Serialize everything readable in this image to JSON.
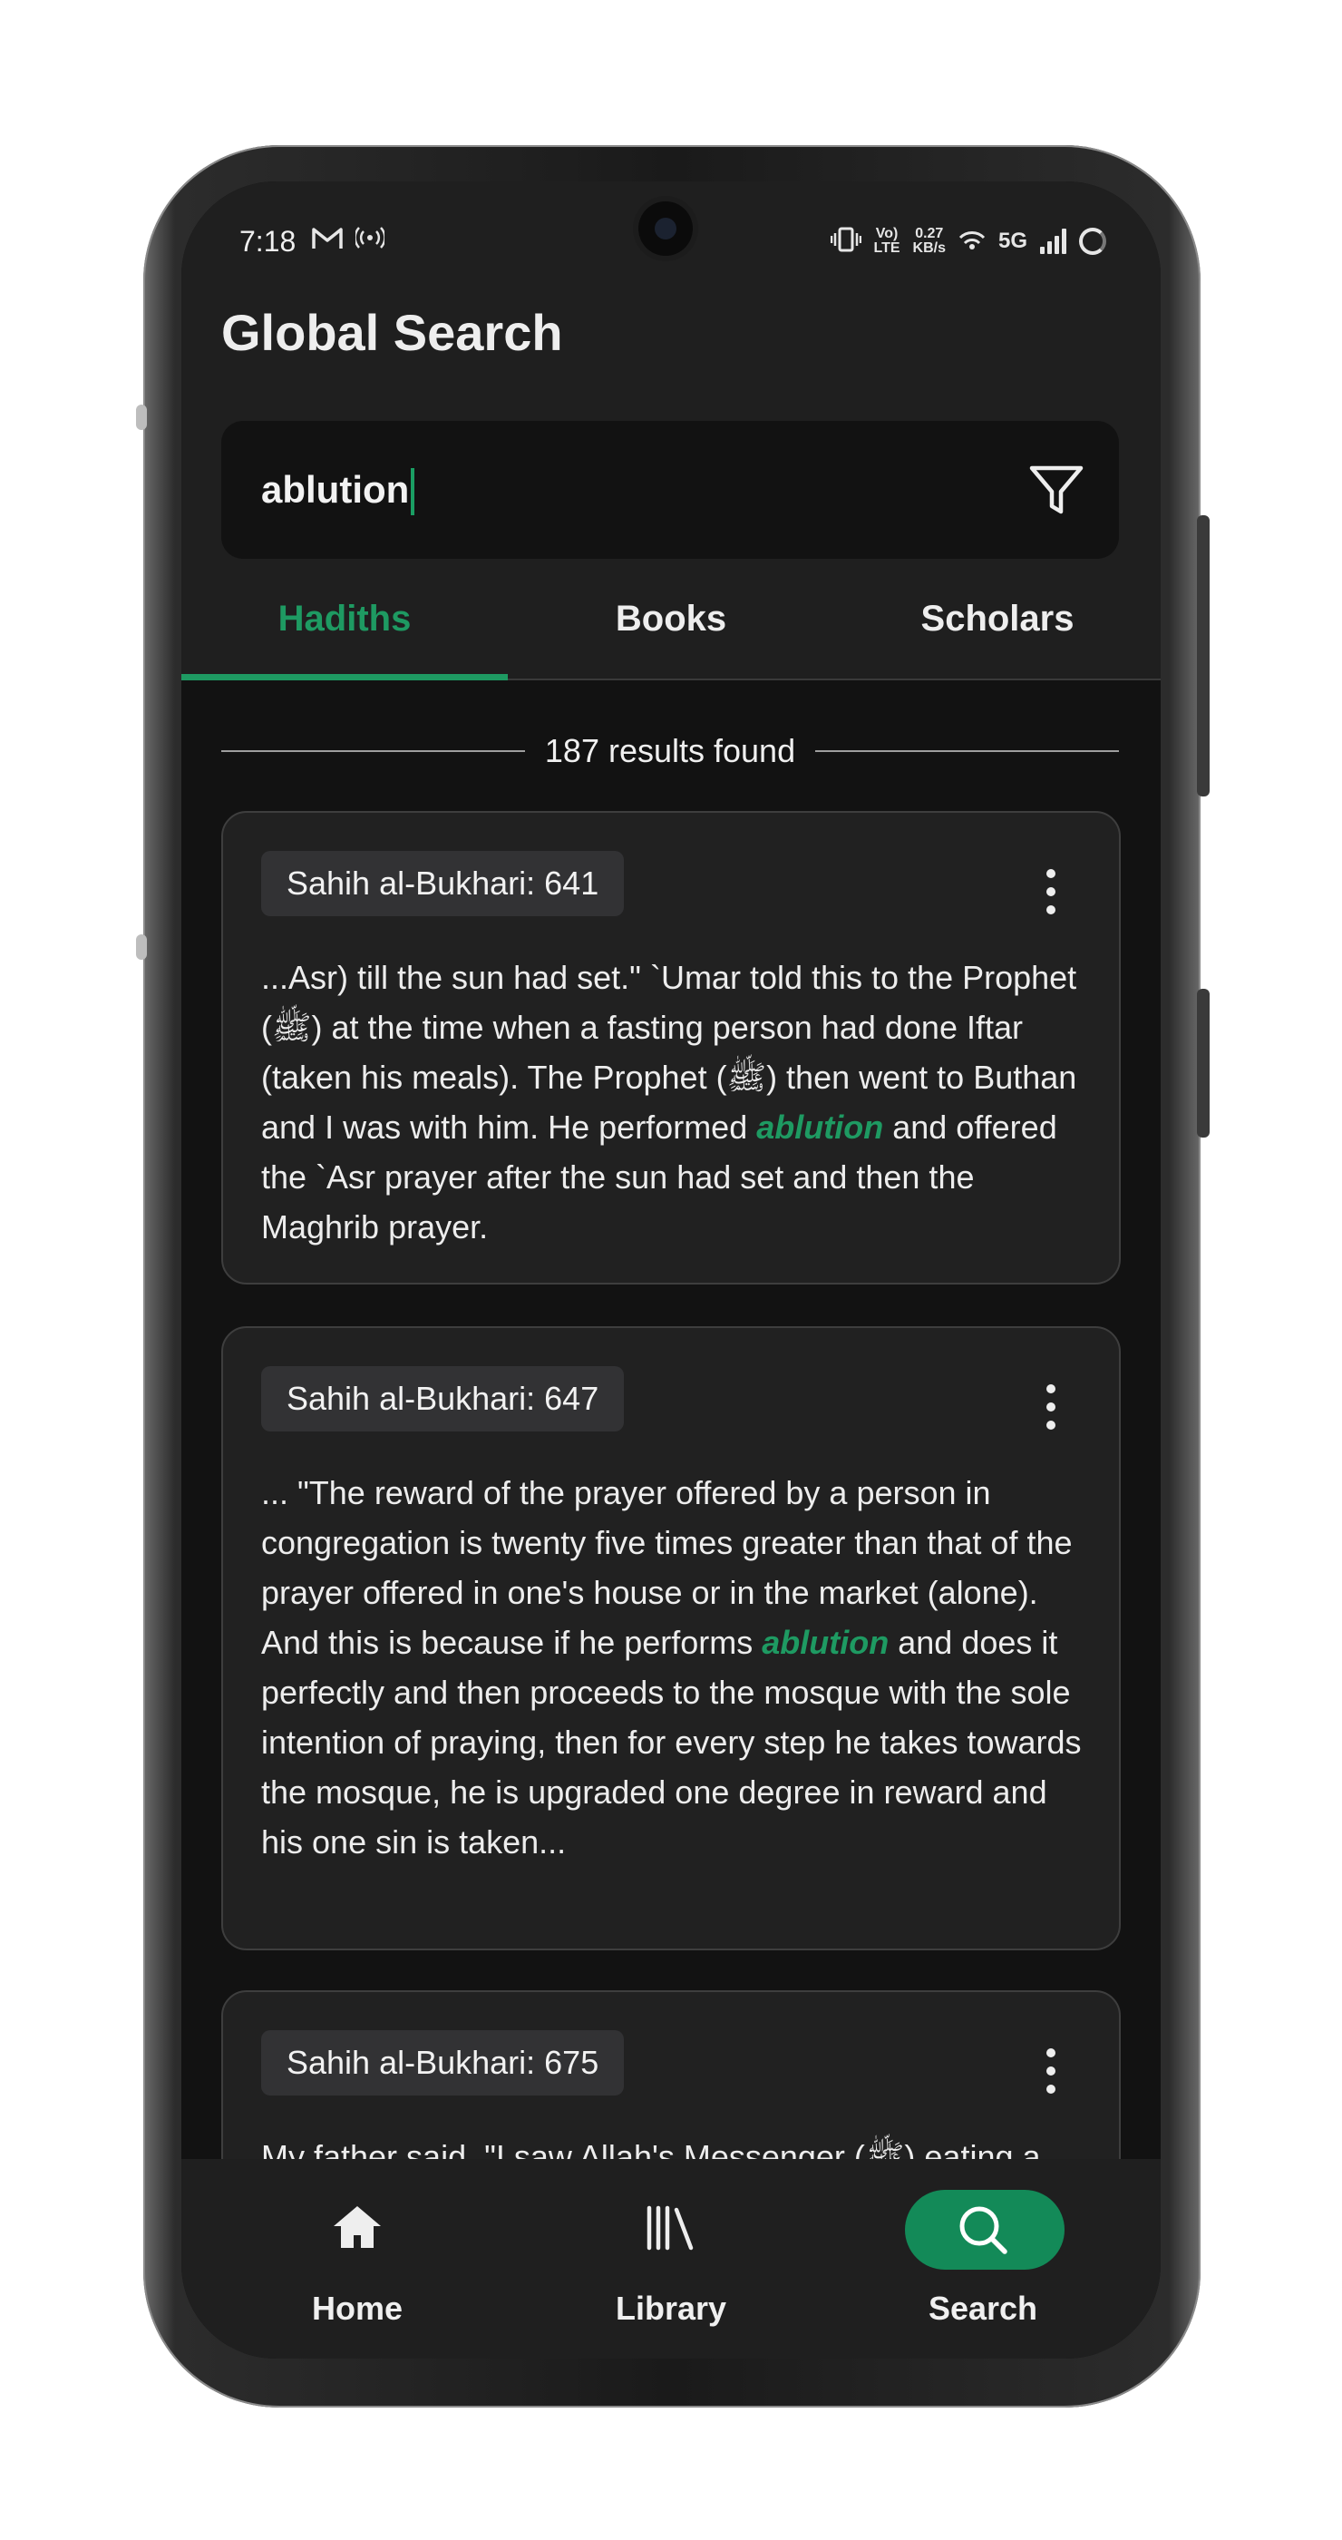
{
  "status_bar": {
    "time": "7:18",
    "icons": [
      "gmail-icon",
      "hotspot-icon"
    ],
    "right_icons": [
      "vibrate-icon",
      "volte-icon",
      "data-speed",
      "hotspot-icon",
      "5g-icon",
      "signal-icon",
      "battery-ring-icon"
    ],
    "volte_top": "Vo)",
    "volte_bottom": "LTE",
    "speed_value": "0.27",
    "speed_unit": "KB/s",
    "network": "5G"
  },
  "header": {
    "title": "Global Search"
  },
  "search": {
    "query": "ablution",
    "filter_icon": "filter-icon"
  },
  "tabs": [
    {
      "label": "Hadiths",
      "active": true
    },
    {
      "label": "Books",
      "active": false
    },
    {
      "label": "Scholars",
      "active": false
    }
  ],
  "results": {
    "count_text": "187 results found"
  },
  "cards": [
    {
      "reference": "Sahih al-Bukhari: 641",
      "text_before": "...Asr) till the sun had set.\" `Umar told this to the Prophet (ﷺ) at the time when a fasting person had done Iftar (taken his meals). The Prophet (ﷺ) then went to Buthan and I was with him. He performed ",
      "highlight": "ablution",
      "text_after": " and offered the `Asr prayer after the sun had set and then the Maghrib prayer."
    },
    {
      "reference": "Sahih al-Bukhari: 647",
      "text_before": "... \"The reward of the prayer offered by a person in congregation is twenty five times greater than that of the prayer offered in one's house or in the market (alone). And this is because if he performs ",
      "highlight": "ablution",
      "text_after": " and does it perfectly and then proceeds to the mosque with the sole intention of praying, then for every step he takes towards the mosque, he is upgraded one degree in reward and his one sin is taken..."
    },
    {
      "reference": "Sahih al-Bukhari: 675",
      "text_before": "My father said, \"I saw Allah's Messenger (ﷺ) eating a",
      "highlight": "",
      "text_after": ""
    }
  ],
  "bottom_nav": [
    {
      "label": "Home",
      "icon": "home-icon",
      "active": false
    },
    {
      "label": "Library",
      "icon": "library-icon",
      "active": false
    },
    {
      "label": "Search",
      "icon": "search-icon",
      "active": true
    }
  ],
  "colors": {
    "accent": "#1e9a62",
    "background": "#121212",
    "surface": "#1f1f1f",
    "card": "#212121"
  }
}
